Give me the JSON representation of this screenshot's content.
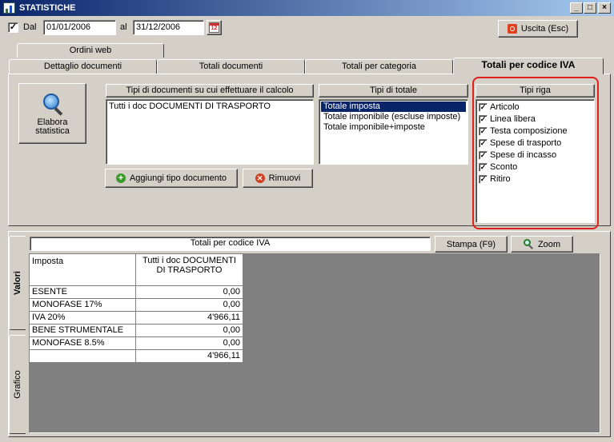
{
  "window": {
    "title": "STATISTICHE",
    "minimize_glyph": "_",
    "maximize_glyph": "□",
    "close_glyph": "×"
  },
  "filters": {
    "dal_checked_glyph": "✓",
    "dal_label": "Dal",
    "date_from": "01/01/2006",
    "al_label": "al",
    "date_to": "31/12/2006",
    "calendar_day": "12"
  },
  "exit_button_label": "Uscita (Esc)",
  "tabs": {
    "ordini_web": "Ordini web",
    "dettaglio_documenti": "Dettaglio documenti",
    "totali_documenti": "Totali documenti",
    "totali_per_categoria": "Totali per categoria",
    "totali_per_codice_iva": "Totali per codice IVA"
  },
  "elabora_button": {
    "line1": "Elabora",
    "line2": "statistica"
  },
  "tipi_documenti": {
    "header": "Tipi di documenti su cui effettuare il calcolo",
    "items": [
      "Tutti i doc DOCUMENTI DI TRASPORTO"
    ]
  },
  "add_doc_type_label": "Aggiungi tipo documento",
  "remove_label": "Rimuovi",
  "tipi_totale": {
    "header": "Tipi di totale",
    "items": [
      "Totale imposta",
      "Totale imponibile (escluse imposte)",
      "Totale imponibile+imposte"
    ]
  },
  "tipi_riga": {
    "header": "Tipi riga",
    "check_glyph": "✓",
    "items": [
      "Articolo",
      "Linea libera",
      "Testa composizione",
      "Spese di trasporto",
      "Spese di incasso",
      "Sconto",
      "Ritiro"
    ]
  },
  "results": {
    "title": "Totali per codice IVA",
    "stampa_label": "Stampa (F9)",
    "zoom_label": "Zoom",
    "vtab_valori": "Valori",
    "vtab_grafico": "Grafico",
    "col_imposta": "Imposta",
    "col_docs_line1": "Tutti i doc DOCUMENTI",
    "col_docs_line2": "DI TRASPORTO",
    "rows": [
      {
        "imposta": "ESENTE",
        "value": "0,00"
      },
      {
        "imposta": "MONOFASE 17%",
        "value": "0,00"
      },
      {
        "imposta": "IVA 20%",
        "value": "4'966,11"
      },
      {
        "imposta": "BENE STRUMENTALE",
        "value": "0,00"
      },
      {
        "imposta": "MONOFASE 8.5%",
        "value": "0,00"
      },
      {
        "imposta": "",
        "value": "4'966,11"
      }
    ]
  },
  "colors": {
    "title_bar": "#0a246a",
    "selection": "#0a246a",
    "highlight_ring": "#e0201a",
    "add_icon": "#3a9a2a",
    "remove_icon": "#d04020",
    "exit_icon": "#e04020"
  }
}
